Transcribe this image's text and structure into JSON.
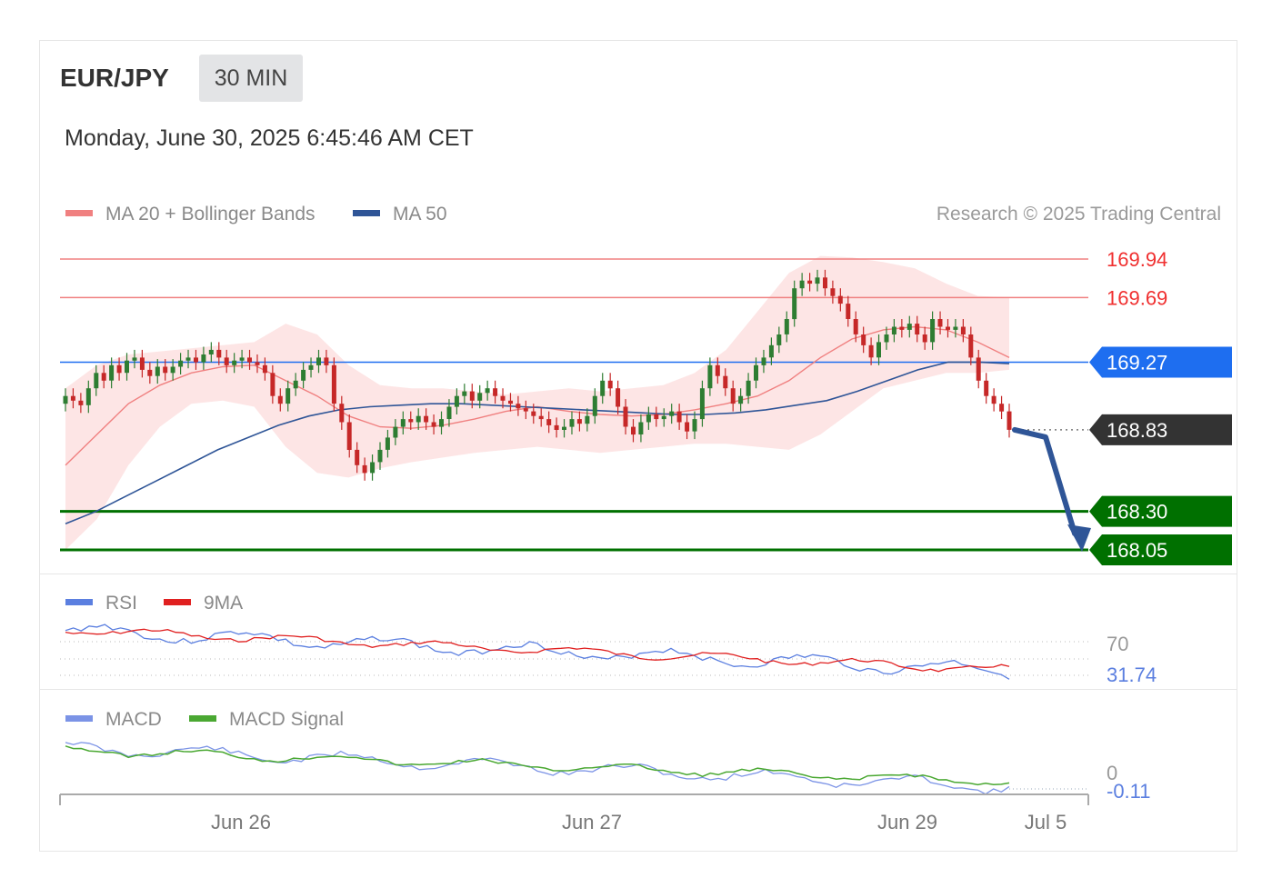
{
  "header": {
    "pair": "EUR/JPY",
    "timeframe": "30 MIN",
    "datetime": "Monday, June 30, 2025 6:45:46 AM CET"
  },
  "legend": {
    "ma20": "MA 20 + Bollinger Bands",
    "ma50": "MA 50",
    "credit": "Research © 2025 Trading Central",
    "rsi": "RSI",
    "rsi_ma": "9MA",
    "macd": "MACD",
    "macd_signal": "MACD Signal"
  },
  "colors": {
    "resistance": "#f08080",
    "support": "#007000",
    "pivot": "#1e6ef0",
    "last_price": "#333333",
    "bollinger_fill": "#fde0e0",
    "ma20": "#f08080",
    "ma50": "#2f5597",
    "candle_up": "#2e7d32",
    "candle_down": "#c62828",
    "projection_arrow": "#2f5597",
    "rsi": "#5b7fe0",
    "rsi_ma": "#e02020",
    "macd": "#7b93e6",
    "macd_signal": "#4aa832"
  },
  "chart_data": {
    "type": "candlestick",
    "instrument": "EUR/JPY",
    "x_ticks": [
      "Jun 26",
      "Jun 27",
      "Jun 29",
      "Jul 5"
    ],
    "levels": [
      {
        "label": "169.94",
        "value": 169.94,
        "kind": "resistance"
      },
      {
        "label": "169.69",
        "value": 169.69,
        "kind": "resistance"
      },
      {
        "label": "169.27",
        "value": 169.27,
        "kind": "pivot"
      },
      {
        "label": "168.83",
        "value": 168.83,
        "kind": "last"
      },
      {
        "label": "168.30",
        "value": 168.3,
        "kind": "support"
      },
      {
        "label": "168.05",
        "value": 168.05,
        "kind": "support"
      }
    ],
    "price_range": [
      168.05,
      169.94
    ],
    "candles_close": [
      169.05,
      169.02,
      168.99,
      169.1,
      169.2,
      169.15,
      169.25,
      169.2,
      169.28,
      169.3,
      169.22,
      169.18,
      169.24,
      169.2,
      169.24,
      169.28,
      169.3,
      169.27,
      169.32,
      169.35,
      169.3,
      169.25,
      169.28,
      169.3,
      169.27,
      169.25,
      169.2,
      169.05,
      169.0,
      169.1,
      169.15,
      169.22,
      169.25,
      169.3,
      169.25,
      169.0,
      168.88,
      168.7,
      168.6,
      168.55,
      168.62,
      168.7,
      168.78,
      168.85,
      168.9,
      168.88,
      168.92,
      168.88,
      168.85,
      168.9,
      168.98,
      169.05,
      169.08,
      169.02,
      169.07,
      169.1,
      169.05,
      169.02,
      169.0,
      168.97,
      168.95,
      168.92,
      168.9,
      168.86,
      168.83,
      168.85,
      168.9,
      168.87,
      168.92,
      169.05,
      169.15,
      169.1,
      168.98,
      168.85,
      168.8,
      168.88,
      168.93,
      168.9,
      168.92,
      168.95,
      168.88,
      168.82,
      168.9,
      169.1,
      169.25,
      169.18,
      169.1,
      169.0,
      169.05,
      169.15,
      169.25,
      169.3,
      169.38,
      169.45,
      169.55,
      169.75,
      169.8,
      169.78,
      169.82,
      169.75,
      169.7,
      169.65,
      169.55,
      169.45,
      169.38,
      169.3,
      169.4,
      169.45,
      169.5,
      169.48,
      169.52,
      169.45,
      169.4,
      169.55,
      169.5,
      169.48,
      169.5,
      169.45,
      169.3,
      169.15,
      169.05,
      169.0,
      168.95,
      168.83
    ],
    "candles_open": [
      169.0,
      169.05,
      169.02,
      168.99,
      169.1,
      169.2,
      169.15,
      169.25,
      169.2,
      169.28,
      169.3,
      169.22,
      169.18,
      169.24,
      169.2,
      169.24,
      169.28,
      169.3,
      169.27,
      169.32,
      169.35,
      169.3,
      169.25,
      169.28,
      169.3,
      169.27,
      169.25,
      169.2,
      169.05,
      169.0,
      169.1,
      169.15,
      169.22,
      169.25,
      169.3,
      169.25,
      169.0,
      168.88,
      168.7,
      168.6,
      168.55,
      168.62,
      168.7,
      168.78,
      168.85,
      168.9,
      168.88,
      168.92,
      168.88,
      168.85,
      168.9,
      168.98,
      169.05,
      169.08,
      169.02,
      169.07,
      169.1,
      169.05,
      169.02,
      169.0,
      168.97,
      168.95,
      168.92,
      168.9,
      168.86,
      168.83,
      168.85,
      168.9,
      168.87,
      168.92,
      169.05,
      169.15,
      169.1,
      168.98,
      168.85,
      168.8,
      168.88,
      168.93,
      168.9,
      168.92,
      168.95,
      168.88,
      168.82,
      168.9,
      169.1,
      169.25,
      169.18,
      169.1,
      169.0,
      169.05,
      169.15,
      169.25,
      169.3,
      169.38,
      169.45,
      169.55,
      169.75,
      169.8,
      169.78,
      169.82,
      169.75,
      169.7,
      169.65,
      169.55,
      169.45,
      169.38,
      169.3,
      169.4,
      169.45,
      169.5,
      169.48,
      169.52,
      169.45,
      169.4,
      169.55,
      169.5,
      169.48,
      169.5,
      169.45,
      169.3,
      169.15,
      169.05,
      169.0,
      168.95
    ],
    "ma50": [
      168.22,
      168.3,
      168.4,
      168.5,
      168.6,
      168.7,
      168.78,
      168.86,
      168.92,
      168.96,
      168.98,
      168.99,
      169.0,
      169.0,
      168.99,
      168.98,
      168.97,
      168.96,
      168.95,
      168.94,
      168.93,
      168.93,
      168.94,
      168.96,
      168.99,
      169.02,
      169.08,
      169.15,
      169.22,
      169.27,
      169.27,
      169.26
    ],
    "ma20": [
      168.6,
      168.8,
      169.0,
      169.12,
      169.2,
      169.24,
      169.25,
      169.15,
      169.05,
      168.92,
      168.85,
      168.84,
      168.86,
      168.9,
      168.95,
      168.98,
      168.95,
      168.93,
      168.92,
      168.93,
      168.96,
      169.0,
      169.05,
      169.15,
      169.3,
      169.42,
      169.48,
      169.5,
      169.48,
      169.4,
      169.3
    ],
    "bb_upper": [
      169.1,
      169.25,
      169.32,
      169.34,
      169.36,
      169.38,
      169.4,
      169.52,
      169.45,
      169.25,
      169.12,
      169.1,
      169.1,
      169.08,
      169.06,
      169.08,
      169.1,
      169.08,
      169.1,
      169.12,
      169.2,
      169.35,
      169.6,
      169.85,
      169.96,
      169.95,
      169.92,
      169.88,
      169.78,
      169.7,
      169.69
    ],
    "bb_lower": [
      168.05,
      168.25,
      168.6,
      168.85,
      169.0,
      169.02,
      168.98,
      168.72,
      168.55,
      168.52,
      168.58,
      168.62,
      168.65,
      168.68,
      168.7,
      168.72,
      168.7,
      168.68,
      168.7,
      168.72,
      168.74,
      168.74,
      168.72,
      168.7,
      168.8,
      168.95,
      169.1,
      169.15,
      169.2,
      169.2,
      169.22
    ],
    "projection": {
      "from": 168.83,
      "to": 168.05
    },
    "rsi": {
      "last_value": "31.74",
      "levels": [
        "70",
        "30"
      ],
      "range": [
        20,
        80
      ]
    },
    "macd": {
      "last_value": "-0.11",
      "zero_label": "0"
    }
  }
}
